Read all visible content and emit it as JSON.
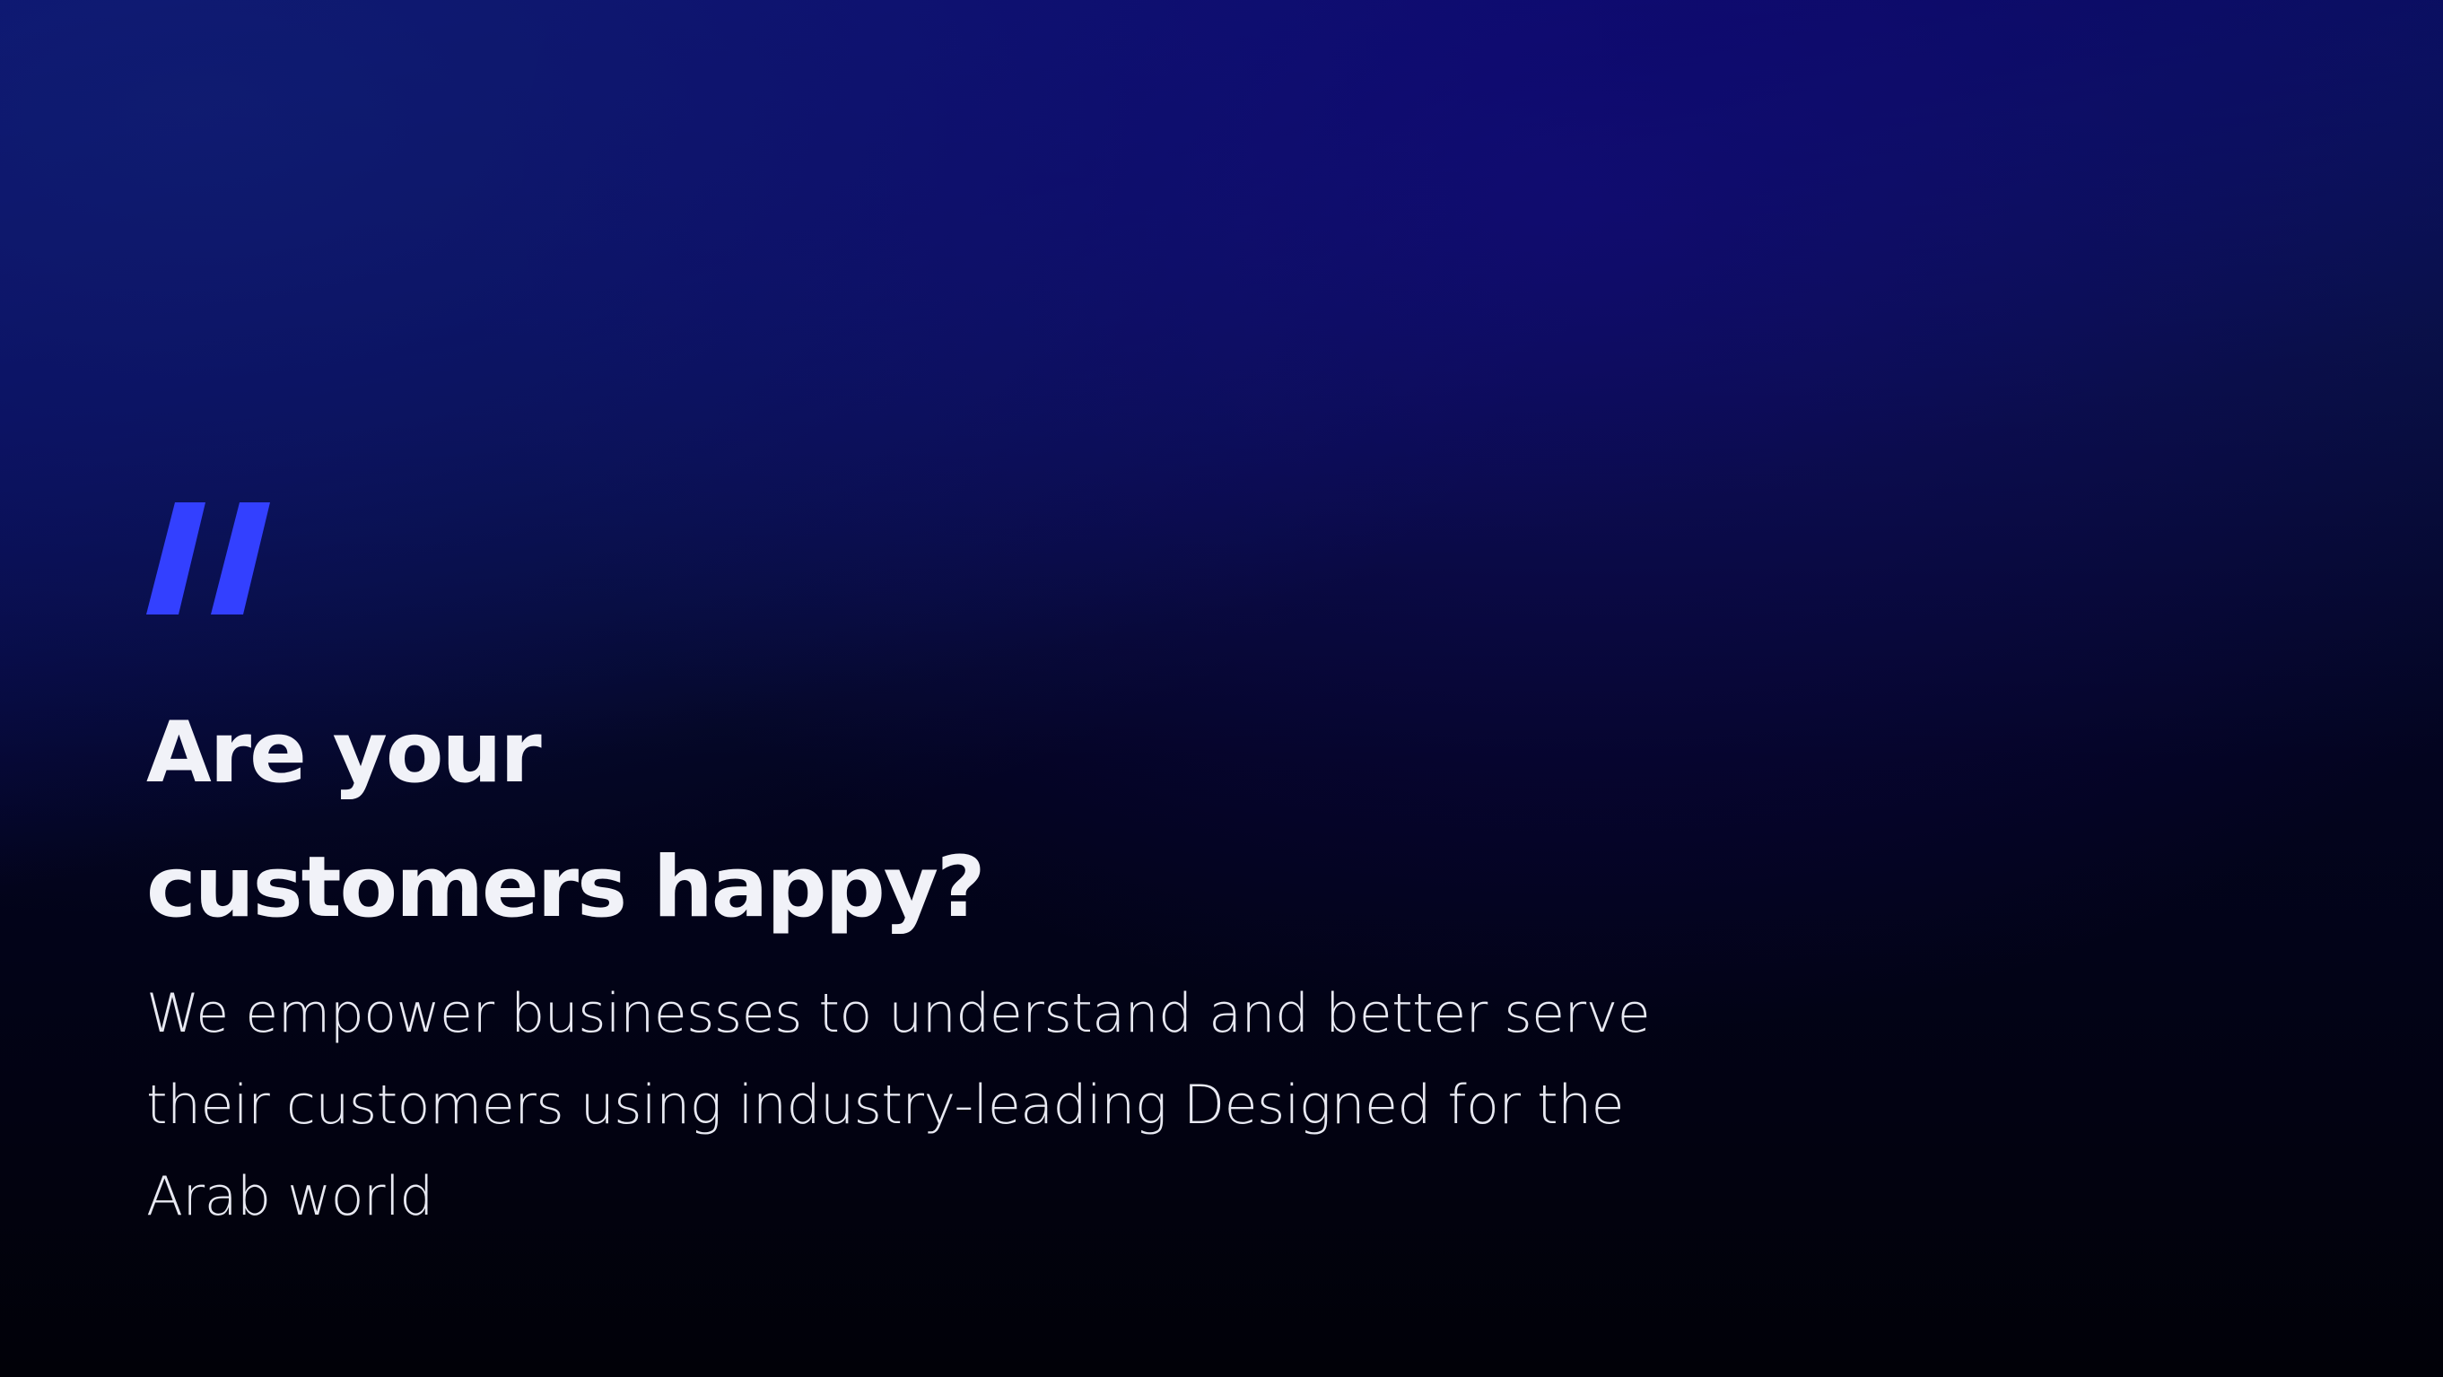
{
  "hero": {
    "quote_icon": "double-slash-quote-icon",
    "headline_line1": "Are your",
    "headline_line2": "customers happy?",
    "body": "We empower businesses to understand and better serve their customers using industry-leading Designed for the Arab world"
  },
  "colors": {
    "accent": "#3340ff",
    "text": "#f1f2f8",
    "background_dark": "#02031a",
    "background_blue": "#0a0c6e"
  }
}
